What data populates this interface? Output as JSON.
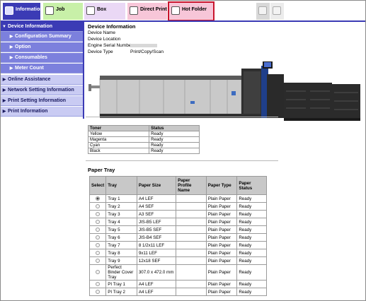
{
  "tabs": [
    {
      "label": "Information",
      "icon": "information-icon"
    },
    {
      "label": "Job",
      "icon": "job-icon"
    },
    {
      "label": "Box",
      "icon": "box-icon"
    },
    {
      "label": "Direct Print",
      "icon": "direct-print-icon"
    },
    {
      "label": "Hot Folder",
      "icon": "hot-folder-icon"
    }
  ],
  "sidebar": {
    "items": [
      {
        "label": "Device Information",
        "arrow": "▼"
      },
      {
        "label": "Configuration Summary",
        "arrow": "▶"
      },
      {
        "label": "Option",
        "arrow": "▶"
      },
      {
        "label": "Consumables",
        "arrow": "▶"
      },
      {
        "label": "Meter Count",
        "arrow": "▶"
      },
      {
        "label": "Online Assistance",
        "arrow": "▶"
      },
      {
        "label": "Network Setting Information",
        "arrow": "▶"
      },
      {
        "label": "Print Setting Information",
        "arrow": "▶"
      },
      {
        "label": "Print Information",
        "arrow": "▶"
      }
    ]
  },
  "device_info": {
    "title": "Device Information",
    "rows": [
      {
        "key": "Device Name",
        "value": ""
      },
      {
        "key": "Device Location",
        "value": ""
      },
      {
        "key": "Engine Serial Number",
        "value": ""
      },
      {
        "key": "Device Type",
        "value": "Print/Copy/Scan"
      }
    ]
  },
  "toner": {
    "headers": [
      "Toner",
      "Status"
    ],
    "rows": [
      [
        "Yellow",
        "Ready"
      ],
      [
        "Magenta",
        "Ready"
      ],
      [
        "Cyan",
        "Ready"
      ],
      [
        "Black",
        "Ready"
      ]
    ]
  },
  "paper_tray": {
    "title": "Paper Tray",
    "headers": [
      "Select",
      "Tray",
      "Paper Size",
      "Paper Profile Name",
      "Paper Type",
      "Paper Status"
    ],
    "rows": [
      {
        "selected": true,
        "tray": "Tray 1",
        "size": "A4 LEF",
        "profile": "",
        "type": "Plain Paper",
        "status": "Ready"
      },
      {
        "selected": false,
        "tray": "Tray 2",
        "size": "A4 SEF",
        "profile": "",
        "type": "Plain Paper",
        "status": "Ready"
      },
      {
        "selected": false,
        "tray": "Tray 3",
        "size": "A3 SEF",
        "profile": "",
        "type": "Plain Paper",
        "status": "Ready"
      },
      {
        "selected": false,
        "tray": "Tray 4",
        "size": "JIS-B5 LEF",
        "profile": "",
        "type": "Plain Paper",
        "status": "Ready"
      },
      {
        "selected": false,
        "tray": "Tray 5",
        "size": "JIS-B5 SEF",
        "profile": "",
        "type": "Plain Paper",
        "status": "Ready"
      },
      {
        "selected": false,
        "tray": "Tray 6",
        "size": "JIS-B4 SEF",
        "profile": "",
        "type": "Plain Paper",
        "status": "Ready"
      },
      {
        "selected": false,
        "tray": "Tray 7",
        "size": "8 1/2x11 LEF",
        "profile": "",
        "type": "Plain Paper",
        "status": "Ready"
      },
      {
        "selected": false,
        "tray": "Tray 8",
        "size": "9x11 LEF",
        "profile": "",
        "type": "Plain Paper",
        "status": "Ready"
      },
      {
        "selected": false,
        "tray": "Tray 9",
        "size": "12x18 SEF",
        "profile": "",
        "type": "Plain Paper",
        "status": "Ready"
      },
      {
        "selected": false,
        "tray": "Perfect Binder Cover Tray",
        "size": "307.0 x 472.0 mm",
        "profile": "",
        "type": "Plain Paper",
        "status": "Ready"
      },
      {
        "selected": false,
        "tray": "PI Tray 1",
        "size": "A4 LEF",
        "profile": "",
        "type": "Plain Paper",
        "status": "Ready"
      },
      {
        "selected": false,
        "tray": "PI Tray 2",
        "size": "A4 LEF",
        "profile": "",
        "type": "Plain Paper",
        "status": "Ready"
      }
    ]
  },
  "colors": {
    "accent": "#3b3bb5",
    "sidebar_sub": "#7c80dd",
    "highlight": "#c8152d"
  }
}
